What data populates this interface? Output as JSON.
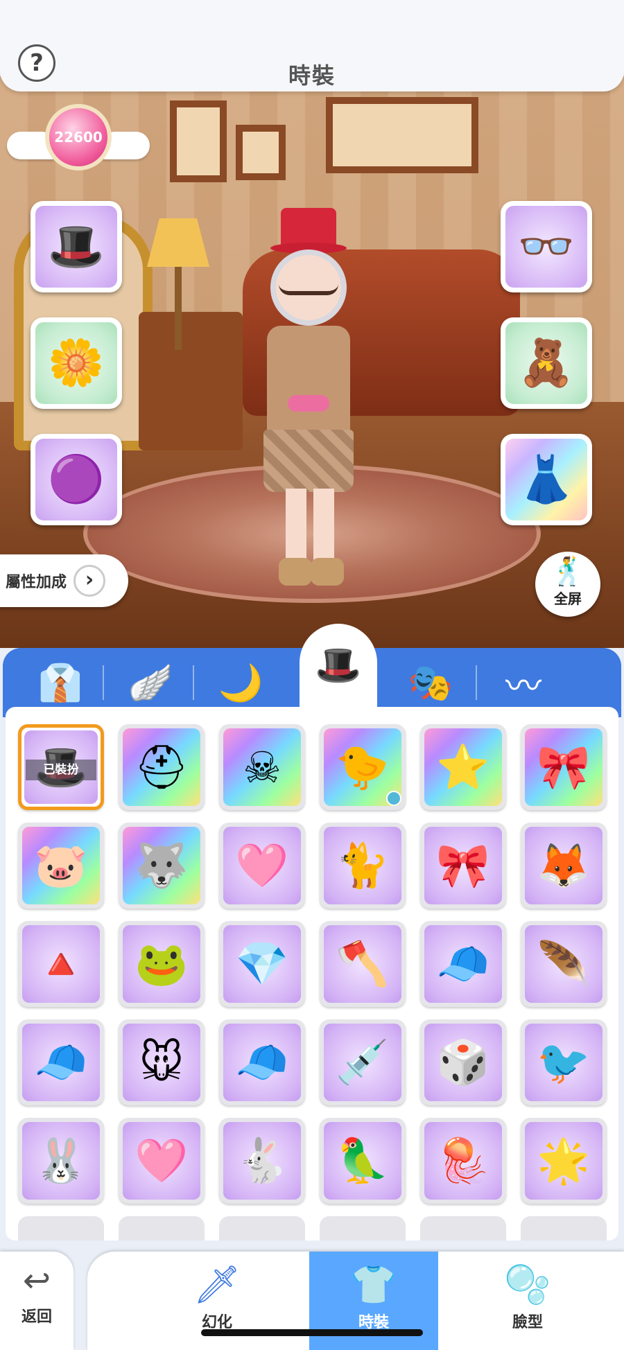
{
  "header": {
    "title": "時裝",
    "help_symbol": "?"
  },
  "currency": {
    "amount": "22600"
  },
  "equipped_left": [
    {
      "name": "red-top-hat-icon",
      "glyph": "🎩",
      "bg": "purple"
    },
    {
      "name": "flower-icon",
      "glyph": "🌼",
      "bg": "green"
    },
    {
      "name": "pink-blob-icon",
      "glyph": "🟣",
      "bg": "purple"
    }
  ],
  "equipped_right": [
    {
      "name": "glasses-icon",
      "glyph": "👓",
      "bg": "purple"
    },
    {
      "name": "red-panda-icon",
      "glyph": "🧸",
      "bg": "green"
    },
    {
      "name": "outfit-icon",
      "glyph": "👗",
      "bg": "rainbow"
    }
  ],
  "attribute_button": {
    "label": "屬性加成",
    "arrow": "›"
  },
  "fullscreen_button": {
    "label": "全屏",
    "icon": "🕺"
  },
  "category_tabs": [
    {
      "name": "tab-clothes",
      "icon": "👔"
    },
    {
      "name": "tab-wings",
      "icon": "🪽"
    },
    {
      "name": "tab-tail",
      "icon": "🌙"
    },
    {
      "name": "tab-headwear",
      "icon": "🎩",
      "active": true
    },
    {
      "name": "tab-mask",
      "icon": "🎭"
    },
    {
      "name": "tab-mouth",
      "icon": "〰"
    }
  ],
  "items": [
    {
      "name": "red-top-hat",
      "glyph": "🎩",
      "bg": "purple",
      "selected": true,
      "badge": "已裝扮"
    },
    {
      "name": "golden-helmet",
      "glyph": "⛑",
      "bg": "rainbow"
    },
    {
      "name": "pirate-hat",
      "glyph": "☠",
      "bg": "rainbow"
    },
    {
      "name": "yellow-chick",
      "glyph": "🐤",
      "bg": "rainbow",
      "dot": true
    },
    {
      "name": "golden-star",
      "glyph": "⭐",
      "bg": "rainbow"
    },
    {
      "name": "pink-ribbon",
      "glyph": "🎀",
      "bg": "rainbow"
    },
    {
      "name": "pig",
      "glyph": "🐷",
      "bg": "rainbow"
    },
    {
      "name": "anubis-mask",
      "glyph": "🐺",
      "bg": "rainbow"
    },
    {
      "name": "pink-poring",
      "glyph": "🩷",
      "bg": "purple"
    },
    {
      "name": "cat",
      "glyph": "🐈",
      "bg": "purple"
    },
    {
      "name": "maid-headband",
      "glyph": "🎀",
      "bg": "purple"
    },
    {
      "name": "fox-mask",
      "glyph": "🦊",
      "bg": "purple"
    },
    {
      "name": "straw-hat",
      "glyph": "🔺",
      "bg": "purple"
    },
    {
      "name": "frog",
      "glyph": "🐸",
      "bg": "purple"
    },
    {
      "name": "green-crystal",
      "glyph": "💎",
      "bg": "purple"
    },
    {
      "name": "axe",
      "glyph": "🪓",
      "bg": "purple"
    },
    {
      "name": "fez-hat",
      "glyph": "🧢",
      "bg": "purple"
    },
    {
      "name": "silver-wreath",
      "glyph": "🪶",
      "bg": "purple"
    },
    {
      "name": "printed-cap",
      "glyph": "🧢",
      "bg": "purple"
    },
    {
      "name": "chef-mouse",
      "glyph": "🐭",
      "bg": "purple"
    },
    {
      "name": "blue-cap",
      "glyph": "🧢",
      "bg": "purple"
    },
    {
      "name": "syringe",
      "glyph": "💉",
      "bg": "purple"
    },
    {
      "name": "dice",
      "glyph": "🎲",
      "bg": "purple"
    },
    {
      "name": "orange-bird",
      "glyph": "🐦",
      "bg": "purple"
    },
    {
      "name": "bunny-ears",
      "glyph": "🐰",
      "bg": "purple"
    },
    {
      "name": "pink-drop",
      "glyph": "🩷",
      "bg": "purple"
    },
    {
      "name": "white-lunatic",
      "glyph": "🐇",
      "bg": "purple"
    },
    {
      "name": "red-parrot",
      "glyph": "🦜",
      "bg": "purple"
    },
    {
      "name": "jellyfish",
      "glyph": "🪼",
      "bg": "purple"
    },
    {
      "name": "nightcap",
      "glyph": "🌟",
      "bg": "purple"
    }
  ],
  "bottom_nav": {
    "back": {
      "label": "返回",
      "icon": "↩"
    },
    "items": [
      {
        "name": "nav-transform",
        "label": "幻化",
        "icon": "🗡"
      },
      {
        "name": "nav-fashion",
        "label": "時裝",
        "icon": "👕",
        "active": true
      },
      {
        "name": "nav-face",
        "label": "臉型",
        "icon": "🫧"
      }
    ]
  }
}
